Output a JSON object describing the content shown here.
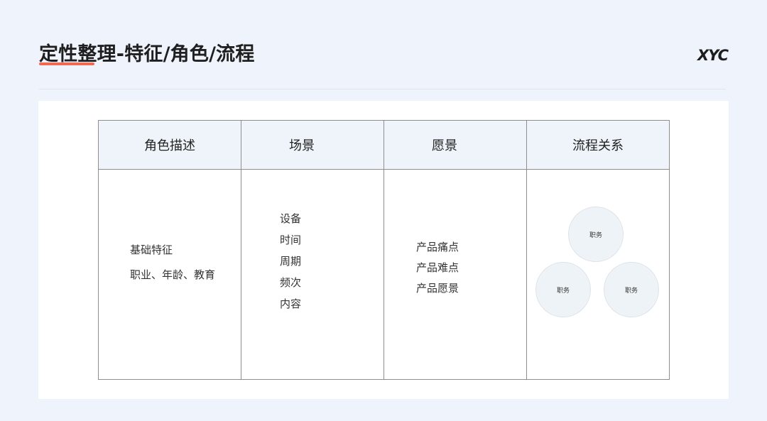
{
  "slide": {
    "title": "定性整理-特征/角色/流程",
    "logo": "XYC"
  },
  "table": {
    "headers": [
      "角色描述",
      "场景",
      "愿景",
      "流程关系"
    ],
    "role": [
      "基础特征",
      "职业、年龄、教育"
    ],
    "scene": [
      "设备",
      "时间",
      "周期",
      "频次",
      "内容"
    ],
    "vision": [
      "产品痛点",
      "产品难点",
      "产品愿景"
    ],
    "flow": [
      "职务",
      "职务",
      "职务"
    ]
  },
  "colors": {
    "background": "#eff3fb",
    "accent": "#f06a52",
    "header_fill": "#eef4f9",
    "circle_fill": "#eef3f8"
  }
}
